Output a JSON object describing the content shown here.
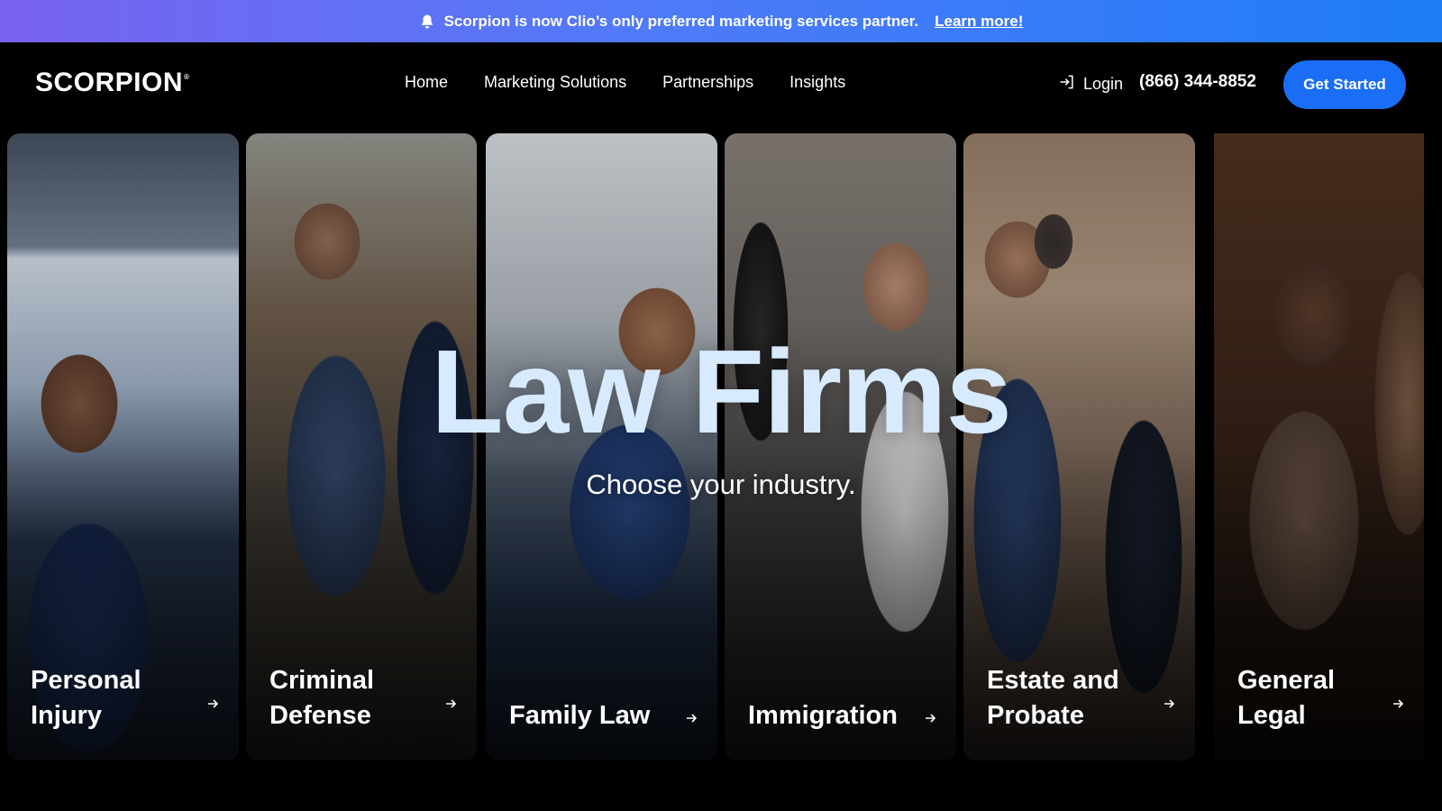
{
  "announcement": {
    "text": "Scorpion is now Clio’s only preferred marketing services partner.",
    "link_label": "Learn more!"
  },
  "header": {
    "logo_text": "SCORPION",
    "logo_mark": "®",
    "nav": [
      "Home",
      "Marketing Solutions",
      "Partnerships",
      "Insights"
    ],
    "login_label": "Login",
    "phone": "(866) 344-8852",
    "cta_label": "Get Started"
  },
  "hero": {
    "title": "Law Firms",
    "subtitle": "Choose your industry."
  },
  "industries": [
    {
      "label": "Personal Injury"
    },
    {
      "label": "Criminal Defense"
    },
    {
      "label": "Family Law"
    },
    {
      "label": "Immigration"
    },
    {
      "label": "Estate and Probate"
    },
    {
      "label": "General Legal"
    }
  ],
  "colors": {
    "accent": "#1a6ef5",
    "banner_start": "#7a63f0",
    "banner_end": "#1e7cf7",
    "hero_title": "#d7eaff"
  },
  "icons": {
    "announcement": "bell-icon",
    "login": "login-arrow-icon",
    "card": "arrow-right-icon"
  }
}
